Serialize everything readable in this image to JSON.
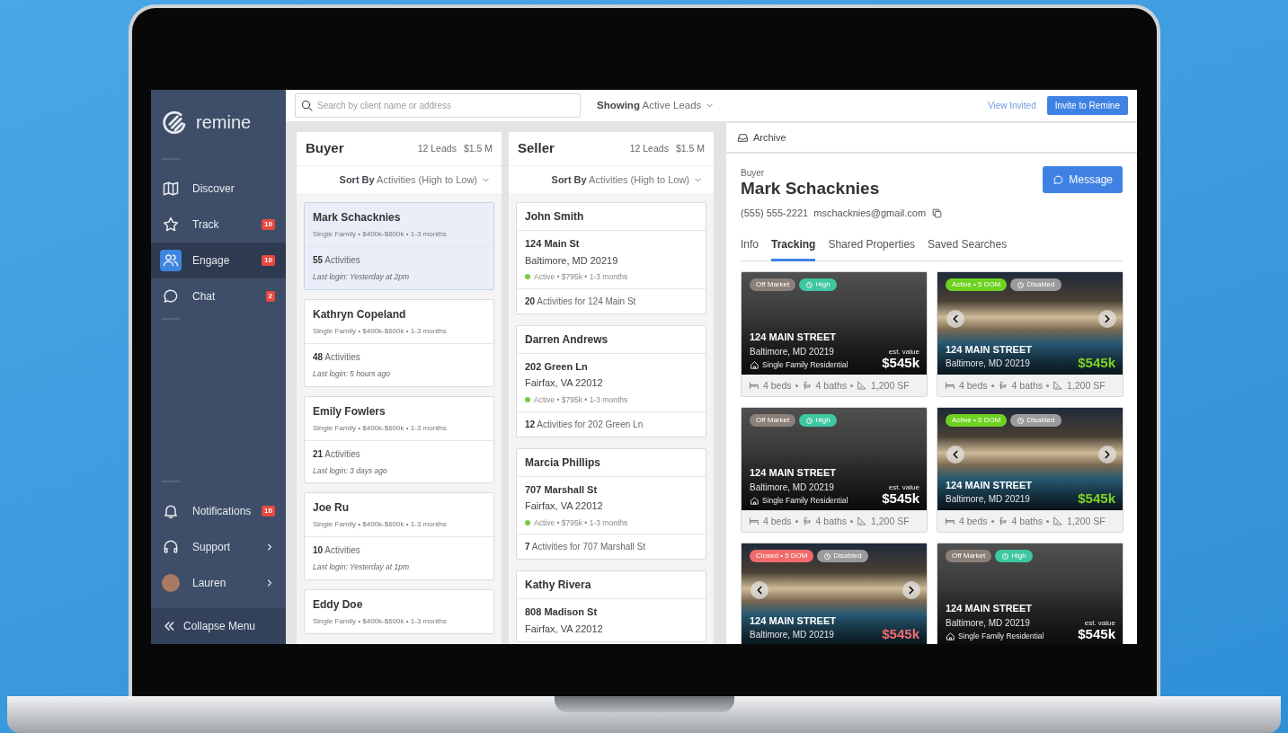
{
  "sidebar": {
    "logo": "remine",
    "items": [
      {
        "label": "Discover",
        "selected": false,
        "submenu": false
      },
      {
        "label": "Track",
        "badge": "10",
        "selected": false,
        "submenu": false
      },
      {
        "label": "Engage",
        "badge": "10",
        "selected": true,
        "submenu": false
      },
      {
        "label": "Chat",
        "badge": "2",
        "selected": false,
        "submenu": false
      }
    ],
    "bottom_items": [
      {
        "label": "Notifications",
        "badge": "10",
        "selected": false,
        "submenu": false
      },
      {
        "label": "Support",
        "selected": false,
        "submenu": true
      },
      {
        "label": "Lauren",
        "selected": false,
        "submenu": true
      }
    ],
    "collapse": "Collapse Menu"
  },
  "toolbar": {
    "search": {
      "placeholder": "Search by client name or address"
    },
    "filter": "**Showing** Active Leads",
    "link": "View Invited",
    "button": "Invite to Remine"
  },
  "buyer_column": {
    "title": "Buyer",
    "leads": "12 Leads",
    "total": "$1.5 M",
    "sort": "**Sort By** Activities (High to Low)",
    "cards": [
      {
        "name": "Mark Schacknies",
        "details": "Single Family • $400k-$600k • 1-3 months",
        "activities": "**55** Activities",
        "last_login": "Last login: Yesterday at 2pm",
        "selected": true
      },
      {
        "name": "Kathryn Copeland",
        "details": "Single Family • $400k-$600k • 1-3 months",
        "activities": "**48** Activities",
        "last_login": "Last login: 5 hours ago",
        "selected": false
      },
      {
        "name": "Emily Fowlers",
        "details": "Single Family • $400k-$600k • 1-3 months",
        "activities": "**21** Activities",
        "last_login": "Last login: 3 days ago",
        "selected": false
      },
      {
        "name": "Joe Ru",
        "details": "Single Family • $400k-$600k • 1-3 months",
        "activities": "**10** Activities",
        "last_login": "Last login: Yesterday at 1pm",
        "selected": false
      },
      {
        "name": "Eddy Doe",
        "details": "Single Family • $400k-$600k • 1-3 months",
        "selected": false
      }
    ]
  },
  "seller_column": {
    "title": "Seller",
    "leads": "12 Leads",
    "total": "$1.5 M",
    "sort": "**Sort By** Activities (High to Low)",
    "cards": [
      {
        "name": "John Smith",
        "address": "124 Main St",
        "city": "Baltimore, MD 20219",
        "status": "Active • $795k • 1-3 months",
        "color": "#7ac943",
        "activities": "**20** Activities for 124 Main St",
        "selected": false
      },
      {
        "name": "Darren Andrews",
        "address": "202 Green Ln",
        "city": "Fairfax, VA 22012",
        "status": "Active • $795k • 1-3 months",
        "color": "#7ac943",
        "activities": "**12** Activities for 202 Green Ln",
        "selected": false
      },
      {
        "name": "Marcia Phillips",
        "address": "707 Marshall St",
        "city": "Fairfax, VA 22012",
        "status": "Active • $795k • 1-3 months",
        "color": "#7ac943",
        "activities": "**7** Activities for 707 Marshall St",
        "selected": false
      },
      {
        "name": "Kathy Rivera",
        "address": "808 Madison St",
        "city": "Fairfax, VA 22012",
        "selected": false
      }
    ]
  },
  "detail": {
    "archive": "Archive",
    "role": "Buyer",
    "name": "Mark Schacknies",
    "phone": "(555) 555-2221",
    "email": "mschacknies@gmail.com",
    "message_button": "Message",
    "tabs": [
      {
        "label": "Info",
        "selected": false
      },
      {
        "label": "Tracking",
        "selected": true
      },
      {
        "label": "Shared Properties",
        "selected": false
      },
      {
        "label": "Saved Searches",
        "selected": false
      }
    ],
    "properties": [
      {
        "kind": "plain",
        "badges": [
          {
            "label": "Off Market",
            "color": "#8a8079"
          },
          {
            "label": "High",
            "color": "#3ec7a1"
          }
        ],
        "street": "124 MAIN STREET",
        "city": "Baltimore, MD 20219",
        "type": "Single Family Residential",
        "value_label": "est. value",
        "price": {
          "text": "$545k",
          "color": "#ffffff"
        },
        "stats": [
          "4 beds",
          "4 baths",
          "1,200 SF"
        ]
      },
      {
        "kind": "photo",
        "badges": [
          {
            "label": "Active • 5 DOM",
            "color": "#6fd122"
          },
          {
            "label": "Disabled",
            "color": "#9b9b9b"
          }
        ],
        "street": "124 MAIN STREET",
        "city": "Baltimore, MD 20219",
        "price": {
          "text": "$545k",
          "color": "#7ed321"
        },
        "stats": [
          "4 beds",
          "4 baths",
          "1,200 SF"
        ]
      },
      {
        "kind": "plain",
        "badges": [
          {
            "label": "Off Market",
            "color": "#8a8079"
          },
          {
            "label": "High",
            "color": "#3ec7a1"
          }
        ],
        "street": "124 MAIN STREET",
        "city": "Baltimore, MD 20219",
        "type": "Single Family Residential",
        "value_label": "est. value",
        "price": {
          "text": "$545k",
          "color": "#ffffff"
        },
        "stats": [
          "4 beds",
          "4 baths",
          "1,200 SF"
        ]
      },
      {
        "kind": "photo",
        "badges": [
          {
            "label": "Active • 5 DOM",
            "color": "#6fd122"
          },
          {
            "label": "Disabled",
            "color": "#9b9b9b"
          }
        ],
        "street": "124 MAIN STREET",
        "city": "Baltimore, MD 20219",
        "price": {
          "text": "$545k",
          "color": "#7ed321"
        },
        "stats": [
          "4 beds",
          "4 baths",
          "1,200 SF"
        ]
      },
      {
        "kind": "photo",
        "badges": [
          {
            "label": "Closed • 5 DOM",
            "color": "#f26b6b"
          },
          {
            "label": "Disabled",
            "color": "#9b9b9b"
          }
        ],
        "street": "124 MAIN STREET",
        "city": "Baltimore, MD 20219",
        "price": {
          "text": "$545k",
          "color": "#f26b6b"
        }
      },
      {
        "kind": "plain",
        "badges": [
          {
            "label": "Off Market",
            "color": "#8a8079"
          },
          {
            "label": "High",
            "color": "#3ec7a1"
          }
        ],
        "street": "124 MAIN STREET",
        "city": "Baltimore, MD 20219",
        "type": "Single Family Residential",
        "value_label": "est. value",
        "price": {
          "text": "$545k",
          "color": "#ffffff"
        }
      }
    ]
  }
}
